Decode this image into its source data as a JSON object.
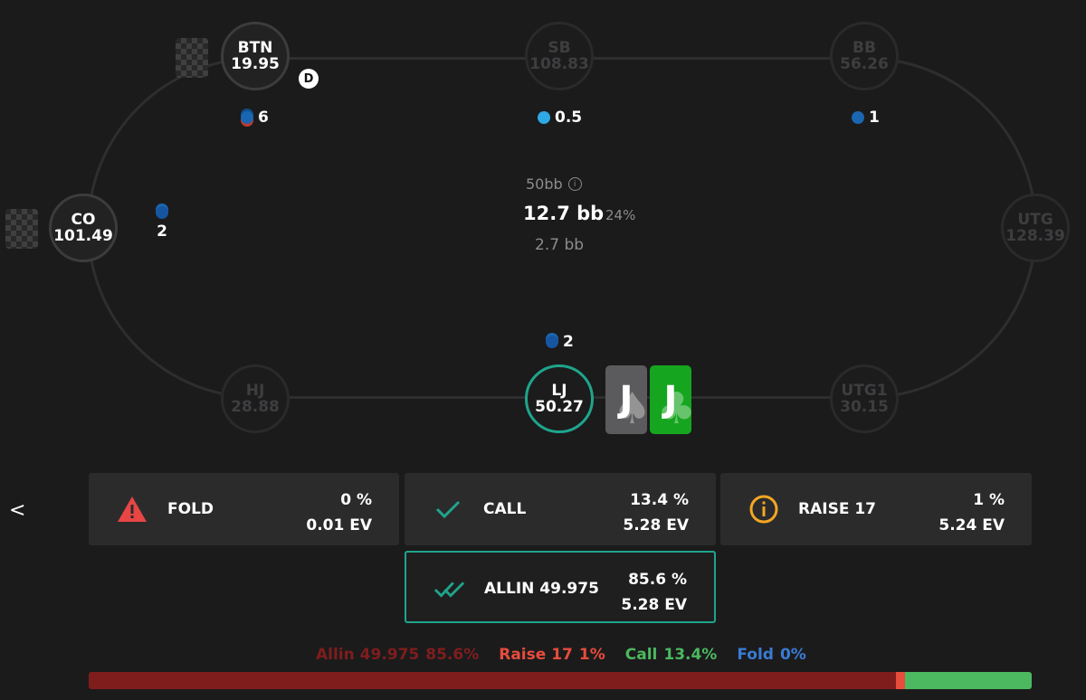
{
  "seats": {
    "btn": {
      "pos": "BTN",
      "stack": "19.95"
    },
    "sb": {
      "pos": "SB",
      "stack": "108.83"
    },
    "bb": {
      "pos": "BB",
      "stack": "56.26"
    },
    "co": {
      "pos": "CO",
      "stack": "101.49"
    },
    "utg": {
      "pos": "UTG",
      "stack": "128.39"
    },
    "hj": {
      "pos": "HJ",
      "stack": "28.88"
    },
    "lj": {
      "pos": "LJ",
      "stack": "50.27"
    },
    "utg1": {
      "pos": "UTG1",
      "stack": "30.15"
    }
  },
  "dealer_label": "D",
  "bets": {
    "btn": "6",
    "sb": "0.5",
    "bb": "1",
    "co": "2",
    "lj": "2"
  },
  "pot": {
    "effective": "50bb",
    "info_icon": "i",
    "main": "12.7 bb",
    "pct": "24%",
    "sub": "2.7 bb"
  },
  "hero_cards": [
    {
      "rank": "J",
      "suit": "spade",
      "suit_glyph": "♠"
    },
    {
      "rank": "J",
      "suit": "club",
      "suit_glyph": "♣"
    }
  ],
  "back_label": "<",
  "actions": {
    "fold": {
      "label": "FOLD",
      "pct": "0 %",
      "ev": "0.01 EV",
      "icon": "warning-icon"
    },
    "call": {
      "label": "CALL",
      "pct": "13.4 %",
      "ev": "5.28 EV",
      "icon": "check-icon"
    },
    "raise": {
      "label": "RAISE 17",
      "pct": "1 %",
      "ev": "5.24 EV",
      "icon": "info-icon"
    },
    "allin": {
      "label": "ALLIN 49.975",
      "pct": "85.6 %",
      "ev": "5.28 EV",
      "icon": "double-check-icon"
    }
  },
  "legend": {
    "allin_name": "Allin 49.975",
    "allin_pct": "85.6%",
    "raise_name": "Raise 17",
    "raise_pct": "1%",
    "call_name": "Call",
    "call_pct": "13.4%",
    "fold_name": "Fold",
    "fold_pct": "0%"
  },
  "colors": {
    "allin": "#7f1d1d",
    "raise": "#e74c3c",
    "call": "#4cb860",
    "fold": "#3a7bd5",
    "accent": "#1fa58c"
  },
  "distribution": {
    "allin": 85.6,
    "raise": 1,
    "call": 13.4,
    "fold": 0
  }
}
